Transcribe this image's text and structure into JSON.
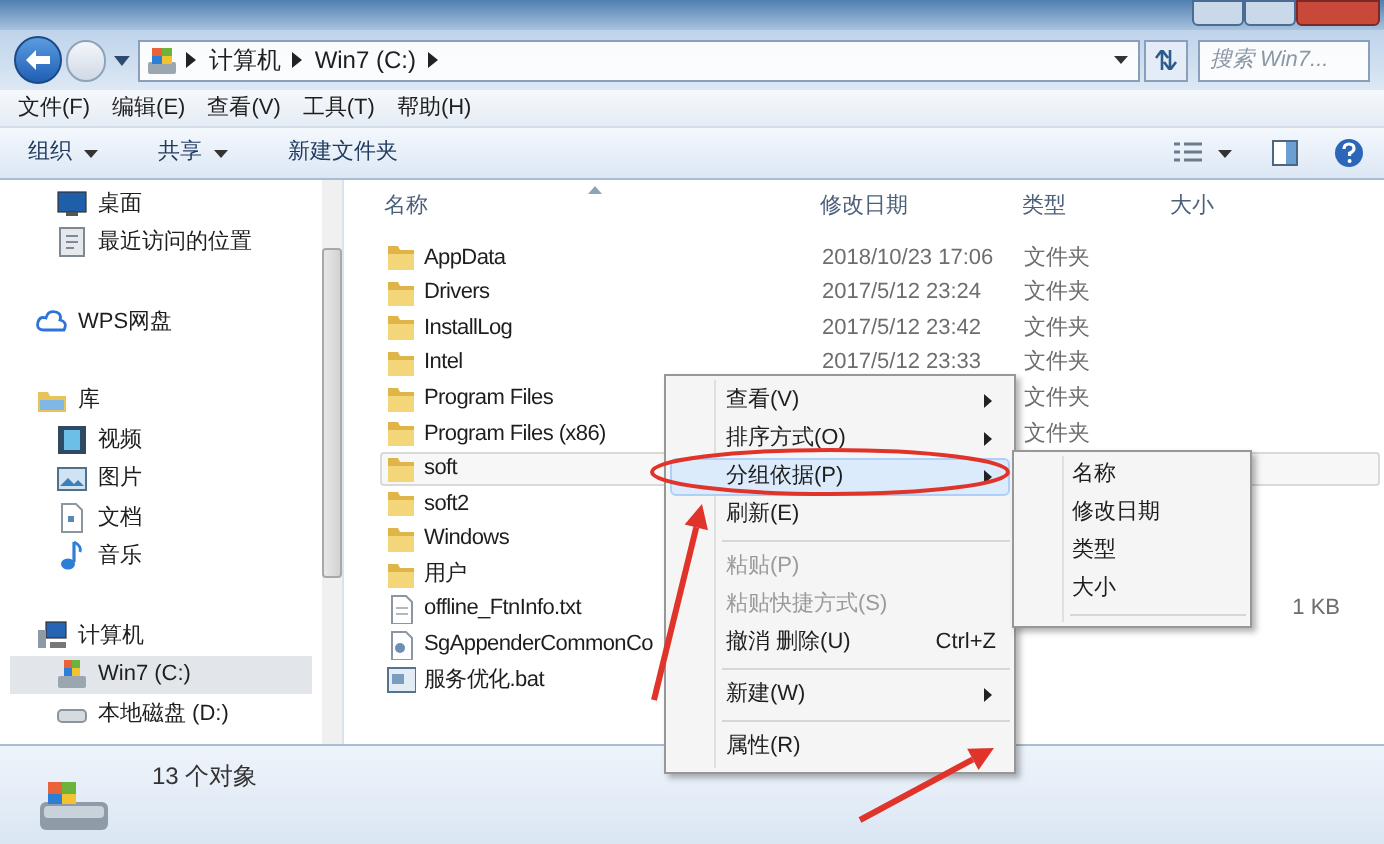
{
  "address_bar": {
    "path": [
      "计算机",
      "Win7 (C:)"
    ]
  },
  "search": {
    "placeholder": "搜索 Win7..."
  },
  "menu_bar": [
    "文件(F)",
    "编辑(E)",
    "查看(V)",
    "工具(T)",
    "帮助(H)"
  ],
  "toolbar": [
    {
      "label": "组织",
      "dropdown": true
    },
    {
      "label": "共享",
      "dropdown": true
    },
    {
      "label": "新建文件夹",
      "dropdown": false
    }
  ],
  "navigation": [
    {
      "children": [
        {
          "label": "桌面",
          "selected": false
        },
        {
          "label": "最近访问的位置",
          "selected": false
        }
      ]
    },
    {
      "label": "WPS网盘",
      "selected": false
    },
    {
      "label": "库",
      "selected": false,
      "children": [
        {
          "label": "视频",
          "selected": false
        },
        {
          "label": "图片",
          "selected": false
        },
        {
          "label": "文档",
          "selected": false
        },
        {
          "label": "音乐",
          "selected": false
        }
      ]
    },
    {
      "label": "计算机",
      "selected": false,
      "children": [
        {
          "label": "Win7 (C:)",
          "selected": true
        },
        {
          "label": "本地磁盘 (D:)",
          "selected": false
        }
      ]
    }
  ],
  "columns": [
    "名称",
    "修改日期",
    "类型",
    "大小"
  ],
  "files": [
    {
      "name": "AppData",
      "kind": "folder",
      "date": "2018/10/23 17:06",
      "type": "文件夹",
      "selected": false
    },
    {
      "name": "Drivers",
      "kind": "folder",
      "date": "2017/5/12 23:24",
      "type": "文件夹",
      "selected": false
    },
    {
      "name": "InstallLog",
      "kind": "folder",
      "date": "2017/5/12 23:42",
      "type": "文件夹",
      "selected": false
    },
    {
      "name": "Intel",
      "kind": "folder",
      "date": "2017/5/12 23:33",
      "type": "文件夹",
      "selected": false
    },
    {
      "name": "Program Files",
      "kind": "folder",
      "type": "文件夹",
      "selected": false
    },
    {
      "name": "Program Files (x86)",
      "kind": "folder",
      "type": "文件夹",
      "selected": false
    },
    {
      "name": "soft",
      "kind": "folder",
      "selected": true
    },
    {
      "name": "soft2",
      "kind": "folder",
      "selected": false
    },
    {
      "name": "Windows",
      "kind": "folder",
      "selected": false
    },
    {
      "name": "用户",
      "kind": "folder",
      "selected": false
    },
    {
      "name": "offline_FtnInfo.txt",
      "kind": "text",
      "size": "1 KB",
      "selected": false
    },
    {
      "name": "SgAppenderCommonCo",
      "kind": "config",
      "selected": false
    },
    {
      "name": "服务优化.bat",
      "kind": "batch",
      "selected": false
    }
  ],
  "context_menu": [
    {
      "kind": "item",
      "label": "查看(V)",
      "submenu": true,
      "disabled": false,
      "highlighted": false
    },
    {
      "kind": "item",
      "label": "排序方式(O)",
      "submenu": true,
      "disabled": false,
      "highlighted": false
    },
    {
      "kind": "item",
      "label": "分组依据(P)",
      "submenu": true,
      "disabled": false,
      "highlighted": true
    },
    {
      "kind": "item",
      "label": "刷新(E)",
      "submenu": false,
      "disabled": false,
      "highlighted": false
    },
    {
      "kind": "separator"
    },
    {
      "kind": "item",
      "label": "粘贴(P)",
      "submenu": false,
      "disabled": true,
      "highlighted": false
    },
    {
      "kind": "item",
      "label": "粘贴快捷方式(S)",
      "submenu": false,
      "disabled": true,
      "highlighted": false
    },
    {
      "kind": "item",
      "label": "撤消 删除(U)",
      "shortcut": "Ctrl+Z",
      "submenu": false,
      "disabled": false,
      "highlighted": false
    },
    {
      "kind": "separator"
    },
    {
      "kind": "item",
      "label": "新建(W)",
      "submenu": true,
      "disabled": false,
      "highlighted": false
    },
    {
      "kind": "separator"
    },
    {
      "kind": "item",
      "label": "属性(R)",
      "submenu": false,
      "disabled": false,
      "highlighted": false
    }
  ],
  "submenu": [
    "名称",
    "修改日期",
    "类型",
    "大小"
  ],
  "status_bar": {
    "text": "13 个对象"
  },
  "annotations": [
    {
      "kind": "ellipse"
    },
    {
      "kind": "arrow"
    },
    {
      "kind": "arrow"
    }
  ]
}
